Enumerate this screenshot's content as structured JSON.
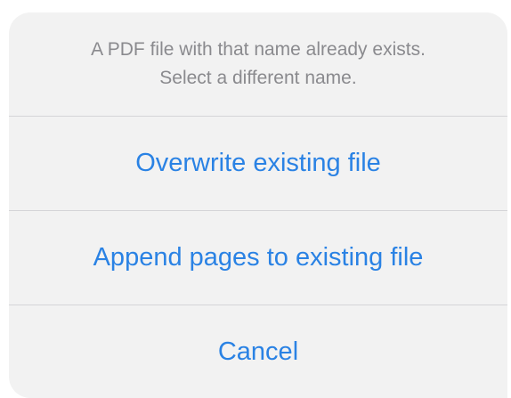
{
  "alert": {
    "message_line_1": "A PDF file with that name already exists.",
    "message_line_2": "Select a different name.",
    "actions": [
      {
        "label": "Overwrite existing file"
      },
      {
        "label": "Append pages to existing file"
      },
      {
        "label": "Cancel"
      }
    ]
  },
  "colors": {
    "sheet_background": "#f2f2f2",
    "message_text": "#8a8a8e",
    "action_text": "#2a82e4",
    "divider": "#d5d5d8"
  }
}
